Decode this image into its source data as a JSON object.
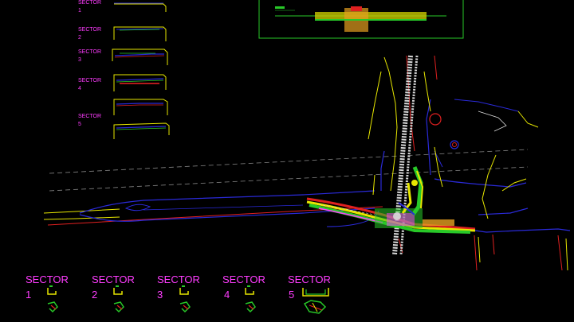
{
  "colors": {
    "background": "#000000",
    "magenta": "#ff3cff",
    "green": "#28c828",
    "yellow": "#e6e600",
    "blue": "#2a2ad8",
    "red": "#e02020",
    "white": "#d8d8d8",
    "gray": "#8a8a8a"
  },
  "sector_sheets": [
    {
      "word": "SECTOR",
      "number": "1"
    },
    {
      "word": "SECTOR",
      "number": "2"
    },
    {
      "word": "SECTOR",
      "number": "3"
    },
    {
      "word": "SECTOR",
      "number": "4"
    },
    {
      "word": "SECTOR",
      "number": "5"
    }
  ],
  "sector_legend": [
    {
      "word": "SECTOR",
      "number": "1"
    },
    {
      "word": "SECTOR",
      "number": "2"
    },
    {
      "word": "SECTOR",
      "number": "3"
    },
    {
      "word": "SECTOR",
      "number": "4"
    },
    {
      "word": "SECTOR",
      "number": "5"
    }
  ],
  "icons": [
    "profile-thumbnail",
    "cross-section-thumbnail",
    "elevation-frame"
  ]
}
